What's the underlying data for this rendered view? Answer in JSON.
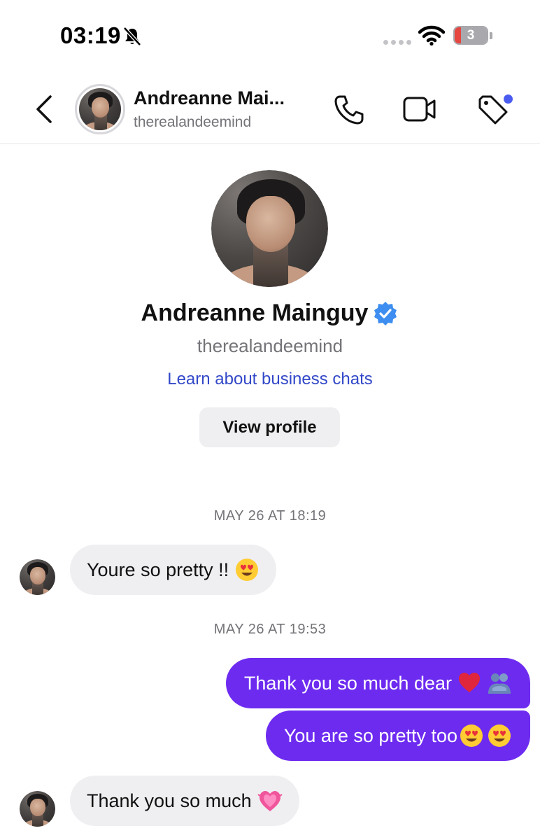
{
  "status_bar": {
    "time": "03:19",
    "battery_level": "3",
    "icons": [
      "bell-muted-icon",
      "cellular-signal-icon",
      "wifi-icon",
      "battery-icon"
    ]
  },
  "header": {
    "name": "Andreanne Mai...",
    "username": "therealandeemind",
    "icons": [
      "back-arrow-icon",
      "phone-icon",
      "video-camera-icon",
      "tag-icon"
    ]
  },
  "profile": {
    "name": "Andreanne Mainguy",
    "verified": true,
    "username": "therealandeemind",
    "business_link": "Learn about business chats",
    "view_profile_label": "View profile"
  },
  "messages": [
    {
      "type": "timestamp",
      "text": "MAY 26 AT 18:19"
    },
    {
      "type": "incoming",
      "text": "Youre so pretty !!",
      "emoji": [
        "heart-eyes-emoji"
      ]
    },
    {
      "type": "timestamp",
      "text": "MAY 26 AT 19:53"
    },
    {
      "type": "outgoing",
      "text": "Thank you so much dear",
      "emoji": [
        "red-heart-emoji",
        "people-hugging-emoji"
      ]
    },
    {
      "type": "outgoing",
      "text": "You are so pretty too",
      "emoji": [
        "heart-eyes-emoji",
        "heart-eyes-emoji"
      ]
    },
    {
      "type": "incoming",
      "text": "Thank you so much",
      "emoji": [
        "growing-heart-emoji"
      ]
    }
  ],
  "colors": {
    "outgoing_bubble": "#6d2bf0",
    "incoming_bubble": "#efeff2",
    "link": "#3248c8",
    "verified_badge": "#3d8ef0",
    "notification_dot": "#4a5cf0"
  }
}
